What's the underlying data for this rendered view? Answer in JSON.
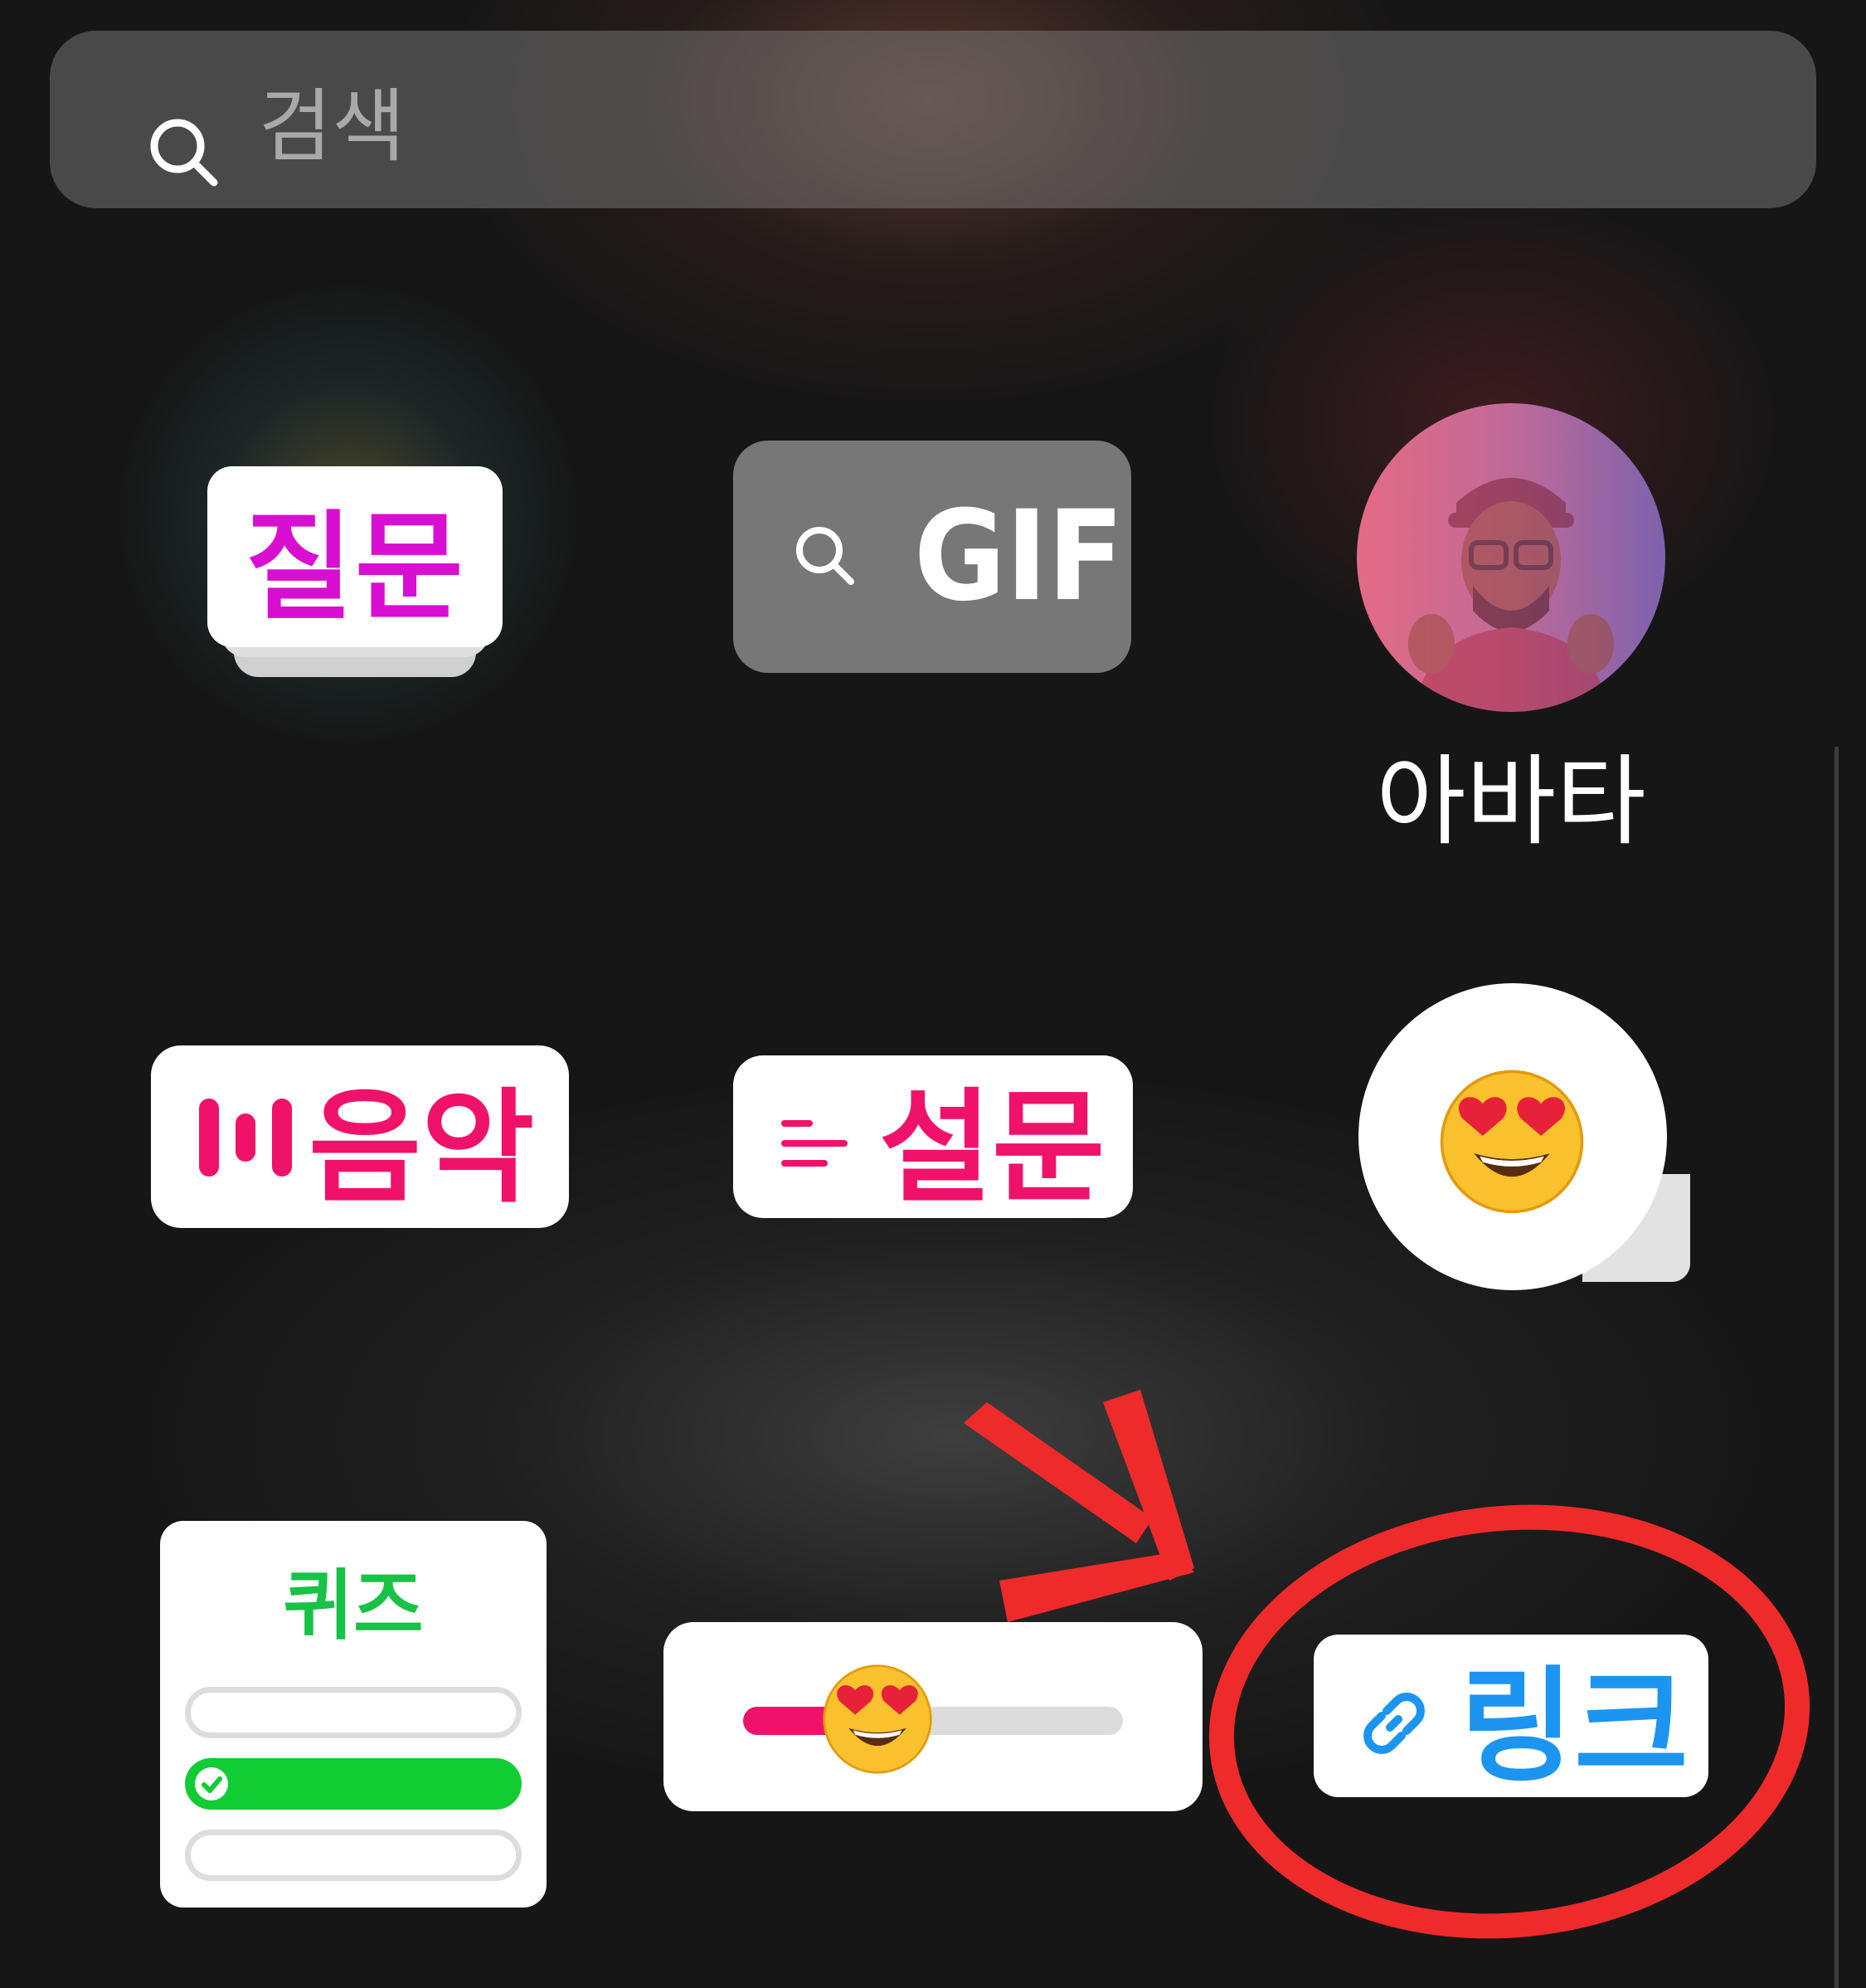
{
  "search": {
    "placeholder": "검색",
    "icon": "search-icon"
  },
  "stickers": {
    "question": {
      "label": "질문",
      "color": "#d80fd0"
    },
    "gif": {
      "label": "GIF",
      "icon": "search-icon"
    },
    "avatar": {
      "label": "아바타"
    },
    "music": {
      "label": "음악",
      "icon": "music-bars-icon",
      "color": "#f0126a"
    },
    "poll": {
      "label": "설문",
      "icon": "poll-lines-icon",
      "color": "#f0126a"
    },
    "emoji_reaction": {
      "emoji": "heart-eyes-emoji"
    },
    "quiz": {
      "title": "퀴즈",
      "color": "#17c247"
    },
    "emoji_slider": {
      "emoji": "heart-eyes-emoji",
      "level": 0.25
    },
    "link": {
      "label": "링크",
      "icon": "link-icon",
      "color": "#1c95f0"
    }
  },
  "annotation": {
    "color": "#ef2a2a",
    "shapes": [
      "arrow",
      "circle"
    ]
  }
}
